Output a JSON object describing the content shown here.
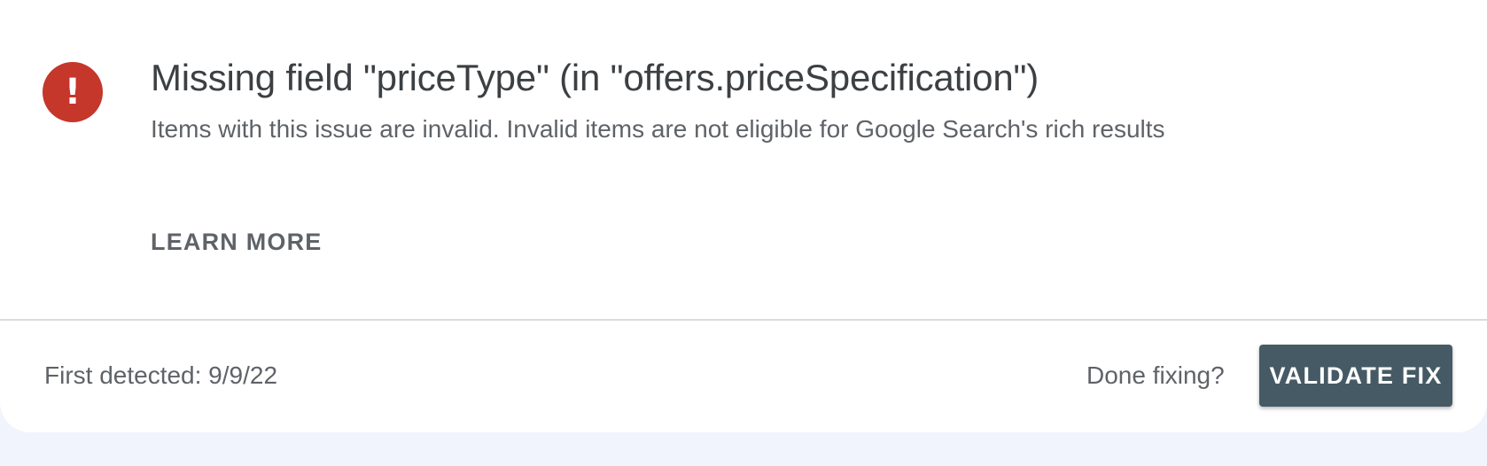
{
  "issue": {
    "icon": "error-icon",
    "icon_glyph": "!",
    "icon_color": "#c5362b",
    "title": "Missing field \"priceType\" (in \"offers.priceSpecification\")",
    "description": "Items with this issue are invalid. Invalid items are not eligible for Google Search's rich results",
    "learn_more_label": "LEARN MORE"
  },
  "footer": {
    "first_detected": "First detected: 9/9/22",
    "done_fixing_label": "Done fixing?",
    "validate_button_label": "VALIDATE FIX",
    "validate_button_color": "#455a64"
  }
}
